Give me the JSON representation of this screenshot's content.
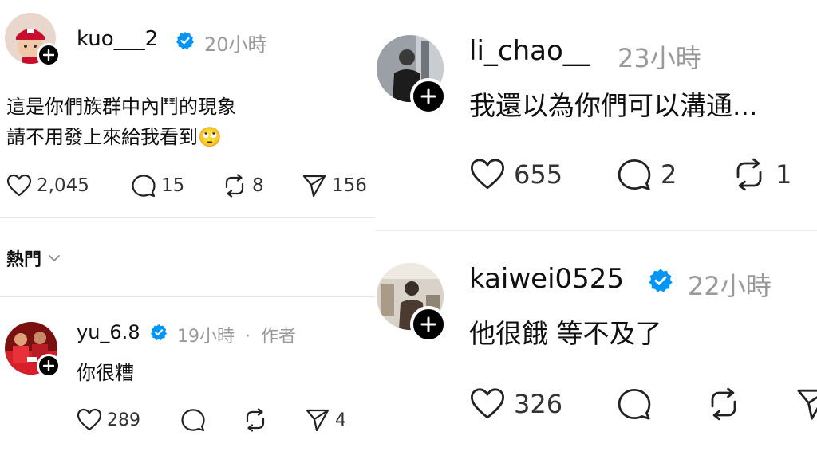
{
  "posts": {
    "kuo": {
      "username": "kuo___2",
      "time": "20小時",
      "line1": "這是你們族群中內鬥的現象",
      "line2": "請不用發上來給我看到",
      "emoji": "🙄",
      "likes": "2,045",
      "replies": "15",
      "reposts": "8",
      "shares": "156"
    },
    "yu": {
      "username": "yu_6.8",
      "time": "19小時",
      "separator": "·",
      "author_tag": "作者",
      "text": "你很糟",
      "likes": "289",
      "shares": "4"
    },
    "li": {
      "username": "li_chao__",
      "time": "23小時",
      "text": "我還以為你們可以溝通...",
      "likes": "655",
      "replies": "2",
      "reposts": "1"
    },
    "kaiwei": {
      "username": "kaiwei0525",
      "time": "22小時",
      "text": "他很餓 等不及了",
      "likes": "326"
    }
  },
  "sort": {
    "label": "熱門"
  },
  "colors": {
    "verified": "#0095f6",
    "muted": "#9a9a9a",
    "badge": "#000000"
  }
}
